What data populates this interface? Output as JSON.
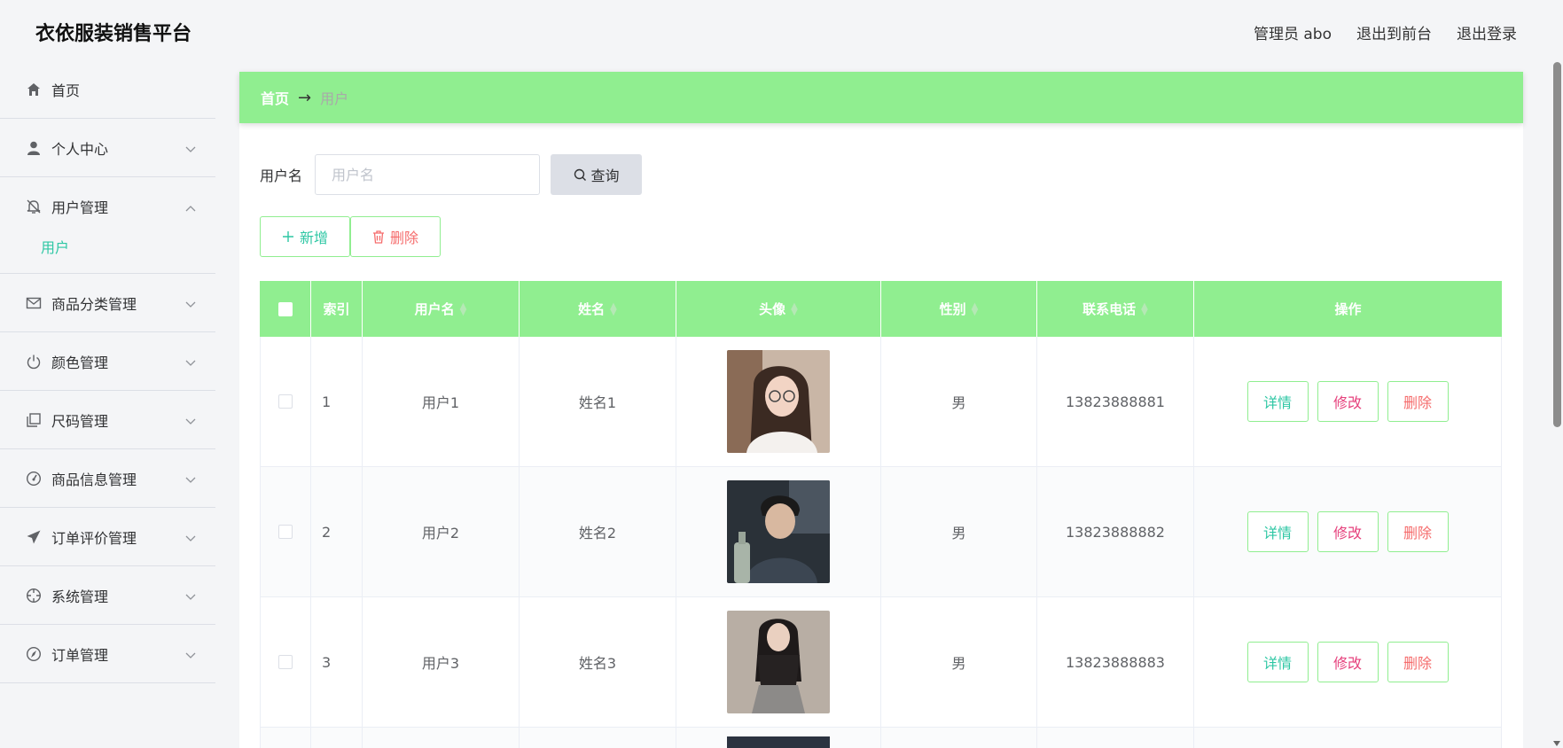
{
  "app": {
    "title": "衣依服装销售平台"
  },
  "header": {
    "admin_label": "管理员 abo",
    "to_front": "退出到前台",
    "logout": "退出登录"
  },
  "sidebar": {
    "items": [
      {
        "label": "首页",
        "icon": "home-icon"
      },
      {
        "label": "个人中心",
        "icon": "user-icon"
      },
      {
        "label": "用户管理",
        "icon": "bell-icon",
        "sub": "用户"
      },
      {
        "label": "商品分类管理",
        "icon": "mail-icon"
      },
      {
        "label": "颜色管理",
        "icon": "power-icon"
      },
      {
        "label": "尺码管理",
        "icon": "copy-icon"
      },
      {
        "label": "商品信息管理",
        "icon": "gauge-icon"
      },
      {
        "label": "订单评价管理",
        "icon": "send-icon"
      },
      {
        "label": "系统管理",
        "icon": "crosshair-icon"
      },
      {
        "label": "订单管理",
        "icon": "compass-icon"
      }
    ]
  },
  "breadcrumb": {
    "home": "首页",
    "current": "用户"
  },
  "search": {
    "label": "用户名",
    "placeholder": "用户名",
    "value": "",
    "button": "查询"
  },
  "actions": {
    "add": "新增",
    "delete": "删除"
  },
  "table": {
    "headers": {
      "index": "索引",
      "username": "用户名",
      "name": "姓名",
      "avatar": "头像",
      "gender": "性别",
      "phone": "联系电话",
      "ops": "操作"
    },
    "ops": {
      "detail": "详情",
      "edit": "修改",
      "delete": "删除"
    },
    "rows": [
      {
        "index": "1",
        "username": "用户1",
        "name": "姓名1",
        "gender": "男",
        "phone": "13823888881"
      },
      {
        "index": "2",
        "username": "用户2",
        "name": "姓名2",
        "gender": "男",
        "phone": "13823888882"
      },
      {
        "index": "3",
        "username": "用户3",
        "name": "姓名3",
        "gender": "男",
        "phone": "13823888883"
      }
    ]
  },
  "colors": {
    "accent_green": "#90ee90",
    "teal": "#2ec7a4",
    "pink": "#e6407c",
    "red": "#f56c6c"
  }
}
